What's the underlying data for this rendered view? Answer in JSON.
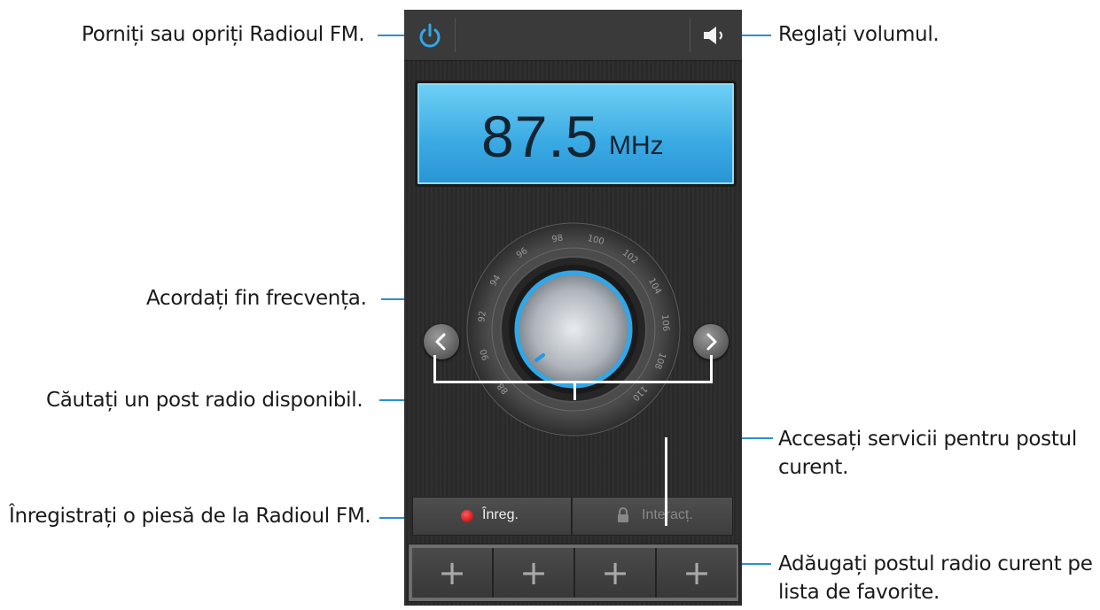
{
  "callouts": {
    "power": "Porniți sau opriți Radioul FM.",
    "volume": "Reglați volumul.",
    "fine_tune": "Acordați fin frecvența.",
    "search": "Căutați un post radio disponibil.",
    "services_line1": "Accesați servicii pentru postul",
    "services_line2": "curent.",
    "record": "Înregistrați o piesă de la Radioul FM.",
    "favorites_line1": "Adăugați postul radio curent pe",
    "favorites_line2": "lista de favorite."
  },
  "display": {
    "frequency": "87.5",
    "unit": "MHz"
  },
  "dial": {
    "ticks": [
      "88",
      "90",
      "92",
      "94",
      "96",
      "98",
      "100",
      "102",
      "104",
      "106",
      "108",
      "110"
    ]
  },
  "actions": {
    "record_label": "Înreg.",
    "interact_label": "Interacț."
  },
  "favorites": [
    "+",
    "+",
    "+",
    "+"
  ],
  "colors": {
    "accent": "#2a8fd0",
    "display": "#39a9e3",
    "record": "#d11f1f"
  },
  "icons": {
    "power": "power-icon",
    "volume": "speaker-icon",
    "prev": "chevron-left-icon",
    "next": "chevron-right-icon",
    "lock": "lock-icon"
  }
}
